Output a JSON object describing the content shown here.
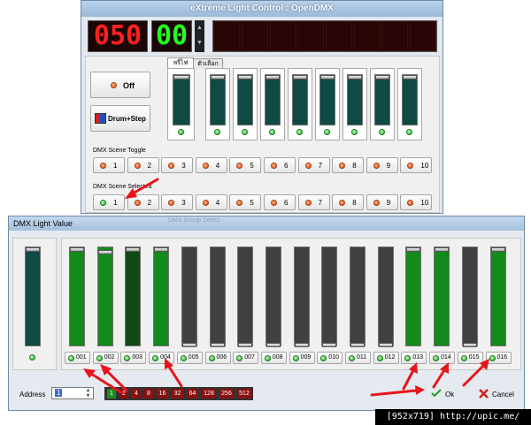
{
  "main_window": {
    "title": "eXtreme Light Control : OpenDMX",
    "display": {
      "red_digits": "050",
      "green_digits": "00"
    },
    "off_button": "Off",
    "drum_step_button": "Drum+Step",
    "tabs": [
      "หรี่ไฟ",
      "ตัวเลือก"
    ],
    "scene_toggle": {
      "label": "DMX Scene Toggle",
      "buttons": [
        "1",
        "2",
        "3",
        "4",
        "5",
        "6",
        "7",
        "8",
        "9",
        "10"
      ]
    },
    "scene_select": {
      "label": "DMX Scene Selected",
      "buttons": [
        "1",
        "2",
        "3",
        "4",
        "5",
        "6",
        "7",
        "8",
        "9",
        "10"
      ],
      "active": "1"
    },
    "group_label_partial": "DMX Group Select"
  },
  "dialog": {
    "title": "DMX Light Value",
    "channels": [
      {
        "label": "001",
        "level": 1.0,
        "on": true
      },
      {
        "label": "002",
        "level": 0.97,
        "on": true
      },
      {
        "label": "003",
        "level": 1.0,
        "on": false
      },
      {
        "label": "004",
        "level": 1.0,
        "on": true
      },
      {
        "label": "005",
        "level": 0.0,
        "on": false
      },
      {
        "label": "006",
        "level": 0.0,
        "on": false
      },
      {
        "label": "007",
        "level": 0.0,
        "on": false
      },
      {
        "label": "008",
        "level": 0.0,
        "on": false
      },
      {
        "label": "009",
        "level": 0.0,
        "on": false
      },
      {
        "label": "010",
        "level": 0.0,
        "on": false
      },
      {
        "label": "011",
        "level": 0.0,
        "on": false
      },
      {
        "label": "012",
        "level": 0.0,
        "on": false
      },
      {
        "label": "013",
        "level": 1.0,
        "on": true
      },
      {
        "label": "014",
        "level": 1.0,
        "on": true
      },
      {
        "label": "015",
        "level": 0.0,
        "on": false
      },
      {
        "label": "016",
        "level": 1.0,
        "on": true
      }
    ],
    "address_label": "Address",
    "address_value": "1",
    "binary": [
      "1",
      "2",
      "4",
      "8",
      "16",
      "32",
      "64",
      "128",
      "256",
      "512"
    ],
    "ok_label": "Ok",
    "cancel_label": "Cancel"
  },
  "footer": {
    "text": "[952x719] http://upic.me/"
  },
  "colors": {
    "green_fader": "#138a1c",
    "dark_green_fader": "#0f4a14",
    "teal_fader": "#0f4a44",
    "gray_fader": "#404040",
    "red": "#e8141c"
  }
}
